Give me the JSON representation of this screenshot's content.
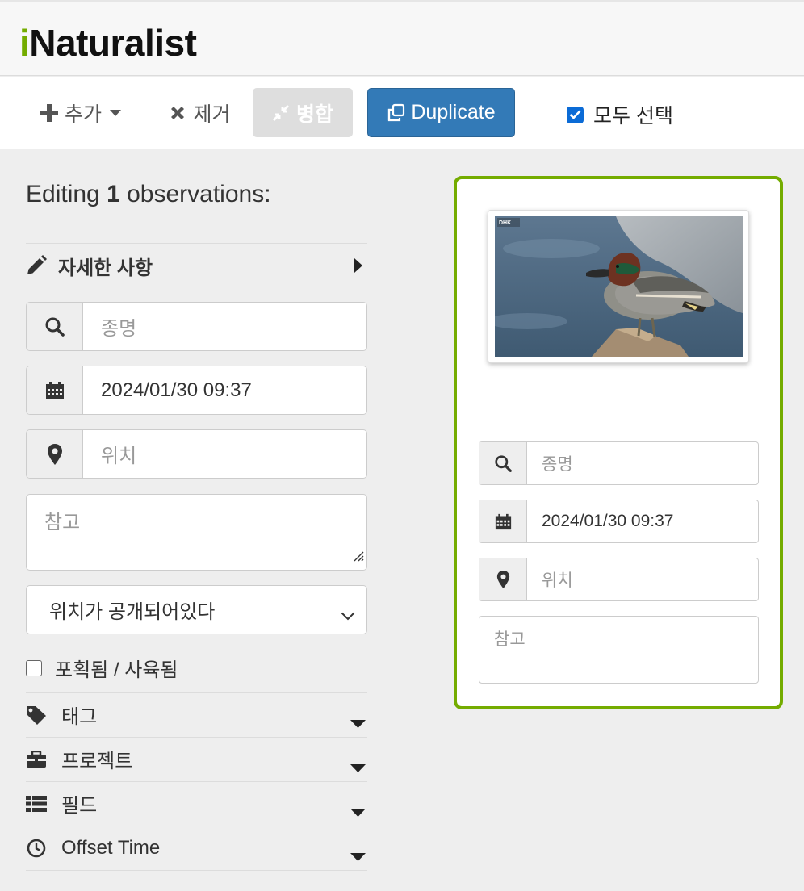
{
  "app": {
    "logo_i": "i",
    "logo_rest": "Naturalist"
  },
  "toolbar": {
    "add_label": "추가",
    "remove_label": "제거",
    "merge_label": "병합",
    "duplicate_label": "Duplicate",
    "select_all_label": "모두 선택",
    "select_all_checked": true
  },
  "editor": {
    "heading_prefix": "Editing",
    "heading_count": "1",
    "heading_suffix": "observations:",
    "details_label": "자세한 사항",
    "species_placeholder": "종명",
    "date_value": "2024/01/30 09:37",
    "location_placeholder": "위치",
    "notes_placeholder": "참고",
    "geoprivacy_value": "위치가 공개되어있다",
    "captive_label": "포획됨 / 사육됨",
    "captive_checked": false,
    "sections": [
      {
        "label": "태그",
        "icon": "tag-icon"
      },
      {
        "label": "프로젝트",
        "icon": "briefcase-icon"
      },
      {
        "label": "필드",
        "icon": "list-icon"
      },
      {
        "label": "Offset Time",
        "icon": "clock-icon"
      }
    ]
  },
  "card": {
    "photo_watermark": "DHK",
    "photo_subject": "green-winged teal duck",
    "species_placeholder": "종명",
    "date_value": "2024/01/30 09:37",
    "location_placeholder": "위치",
    "notes_placeholder": "참고"
  },
  "colors": {
    "brand_green": "#74ac00",
    "primary_blue": "#337ab7",
    "checkbox_blue": "#0b6bd6"
  }
}
